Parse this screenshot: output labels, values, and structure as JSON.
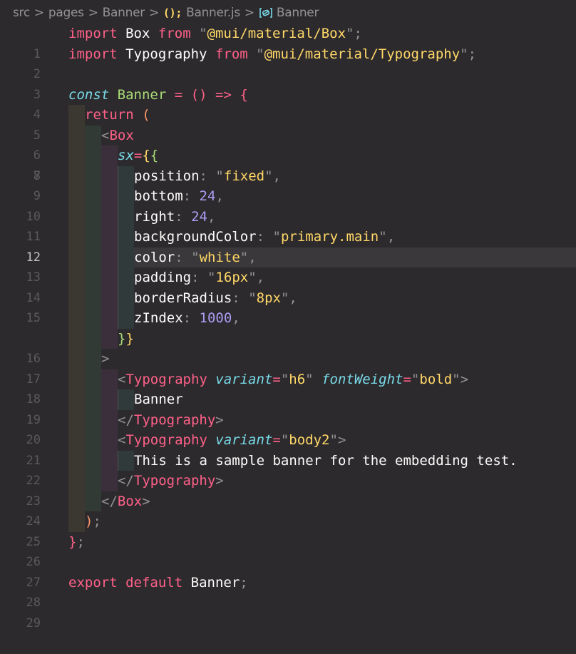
{
  "breadcrumb": {
    "items": [
      "src",
      "pages",
      "Banner",
      "Banner.js",
      "Banner"
    ],
    "separator": ">",
    "icons": {
      "file": "(};",
      "symbol": "variable-icon"
    }
  },
  "editor": {
    "current_line": 12,
    "line_numbers": [
      "1",
      "2",
      "3",
      "4",
      "5",
      "6",
      "7",
      "8",
      "9",
      "10",
      "11",
      "12",
      "13",
      "14",
      "15",
      "16",
      "17",
      "18",
      "19",
      "20",
      "21",
      "22",
      "23",
      "24",
      "25",
      "26",
      "27",
      "28",
      "29"
    ],
    "lines": {
      "l1": {
        "kw": "import",
        "id": "Box",
        "from": "from",
        "q1": "\"",
        "str": "@mui/material/Box",
        "q2": "\"",
        "end": ";"
      },
      "l2": {
        "kw": "import",
        "id": "Typography",
        "from": "from",
        "q1": "\"",
        "str": "@mui/material/Typography",
        "q2": "\"",
        "end": ";"
      },
      "l4": {
        "kw": "const",
        "name": "Banner",
        "eq": "=",
        "parens": "()",
        "arrow": "=>",
        "brace": "{"
      },
      "l5": {
        "kw": "return",
        "paren": "("
      },
      "l6": {
        "lt": "<",
        "tag": "Box"
      },
      "l7": {
        "attr": "sx",
        "eq": "=",
        "b1": "{",
        "b2": "{"
      },
      "props": [
        {
          "key": "position",
          "colon": ":",
          "value": "fixed",
          "type": "string"
        },
        {
          "key": "bottom",
          "colon": ":",
          "value": "24",
          "type": "number"
        },
        {
          "key": "right",
          "colon": ":",
          "value": "24",
          "type": "number"
        },
        {
          "key": "backgroundColor",
          "colon": ":",
          "value": "primary.main",
          "type": "string"
        },
        {
          "key": "color",
          "colon": ":",
          "value": "white",
          "type": "string"
        },
        {
          "key": "padding",
          "colon": ":",
          "value": "16px",
          "type": "string"
        },
        {
          "key": "borderRadius",
          "colon": ":",
          "value": "8px",
          "type": "string"
        },
        {
          "key": "zIndex",
          "colon": ":",
          "value": "1000",
          "type": "number"
        }
      ],
      "l16": {
        "b2": "}",
        "b1": "}"
      },
      "l17": {
        "gt": ">"
      },
      "l18": {
        "lt": "<",
        "tag": "Typography",
        "attr1": "variant",
        "val1": "h6",
        "attr2": "fontWeight",
        "val2": "bold",
        "gt": ">"
      },
      "l19": {
        "text": "Banner"
      },
      "l20": {
        "lt": "</",
        "tag": "Typography",
        "gt": ">"
      },
      "l21": {
        "lt": "<",
        "tag": "Typography",
        "attr1": "variant",
        "val1": "body2",
        "gt": ">"
      },
      "l22": {
        "text": "This is a sample banner for the embedding test."
      },
      "l23": {
        "lt": "</",
        "tag": "Typography",
        "gt": ">"
      },
      "l24": {
        "lt": "</",
        "tag": "Box",
        "gt": ">"
      },
      "l25": {
        "paren": ")",
        "semi": ";"
      },
      "l26": {
        "brace": "}",
        "semi": ";"
      },
      "l28": {
        "kw1": "export",
        "kw2": "default",
        "id": "Banner",
        "semi": ";"
      }
    }
  }
}
